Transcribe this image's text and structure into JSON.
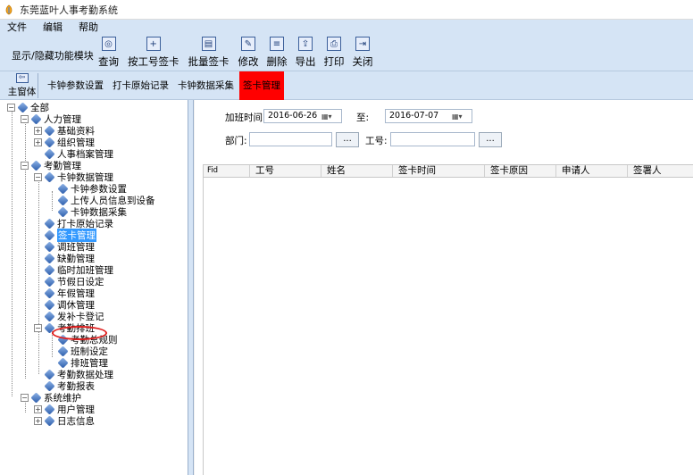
{
  "window": {
    "title": "东莞蓝叶人事考勤系统"
  },
  "menu": [
    "文件",
    "编辑",
    "帮助"
  ],
  "toolbar": {
    "module_toggle": "显示/隐藏功能模块",
    "buttons": [
      {
        "label": "查询",
        "icon": "binoculars-icon"
      },
      {
        "label": "按工号签卡",
        "icon": "sign-by-id-icon"
      },
      {
        "label": "批量签卡",
        "icon": "batch-sign-icon"
      },
      {
        "label": "修改",
        "icon": "edit-icon"
      },
      {
        "label": "删除",
        "icon": "delete-icon"
      },
      {
        "label": "导出",
        "icon": "export-icon"
      },
      {
        "label": "打印",
        "icon": "printer-icon"
      },
      {
        "label": "关闭",
        "icon": "close-door-icon"
      }
    ]
  },
  "tabs": {
    "home": "主窗体",
    "items": [
      "卡钟参数设置",
      "打卡原始记录",
      "卡钟数据采集",
      "签卡管理"
    ],
    "active_index": 3,
    "active_color": "#ff0000"
  },
  "tree": [
    {
      "label": "全部"
    },
    {
      "label": "人力管理"
    },
    {
      "label": "基础资料"
    },
    {
      "label": "组织管理"
    },
    {
      "label": "人事档案管理"
    },
    {
      "label": "考勤管理"
    },
    {
      "label": "卡钟数据管理"
    },
    {
      "label": "卡钟参数设置"
    },
    {
      "label": "上传人员信息到设备"
    },
    {
      "label": "卡钟数据采集"
    },
    {
      "label": "打卡原始记录"
    },
    {
      "label": "签卡管理"
    },
    {
      "label": "调班管理"
    },
    {
      "label": "缺勤管理"
    },
    {
      "label": "临时加班管理"
    },
    {
      "label": "节假日设定"
    },
    {
      "label": "年假管理"
    },
    {
      "label": "调休管理"
    },
    {
      "label": "发补卡登记"
    },
    {
      "label": "考勤排班"
    },
    {
      "label": "考勤总规则"
    },
    {
      "label": "班制设定"
    },
    {
      "label": "排班管理"
    },
    {
      "label": "考勤数据处理"
    },
    {
      "label": "考勤报表"
    },
    {
      "label": "系统维护"
    },
    {
      "label": "用户管理"
    },
    {
      "label": "日志信息"
    }
  ],
  "filters": {
    "from_label": "加班时间:",
    "from_date": "2016-06-26",
    "to_label": "至:",
    "to_date": "2016-07-07",
    "dept_label": "部门:",
    "dept_value": "",
    "emp_label": "工号:",
    "emp_value": "",
    "browse": "..."
  },
  "grid": {
    "columns": [
      "Fid",
      "工号",
      "姓名",
      "签卡时间",
      "签卡原因",
      "申请人",
      "签署人"
    ]
  }
}
